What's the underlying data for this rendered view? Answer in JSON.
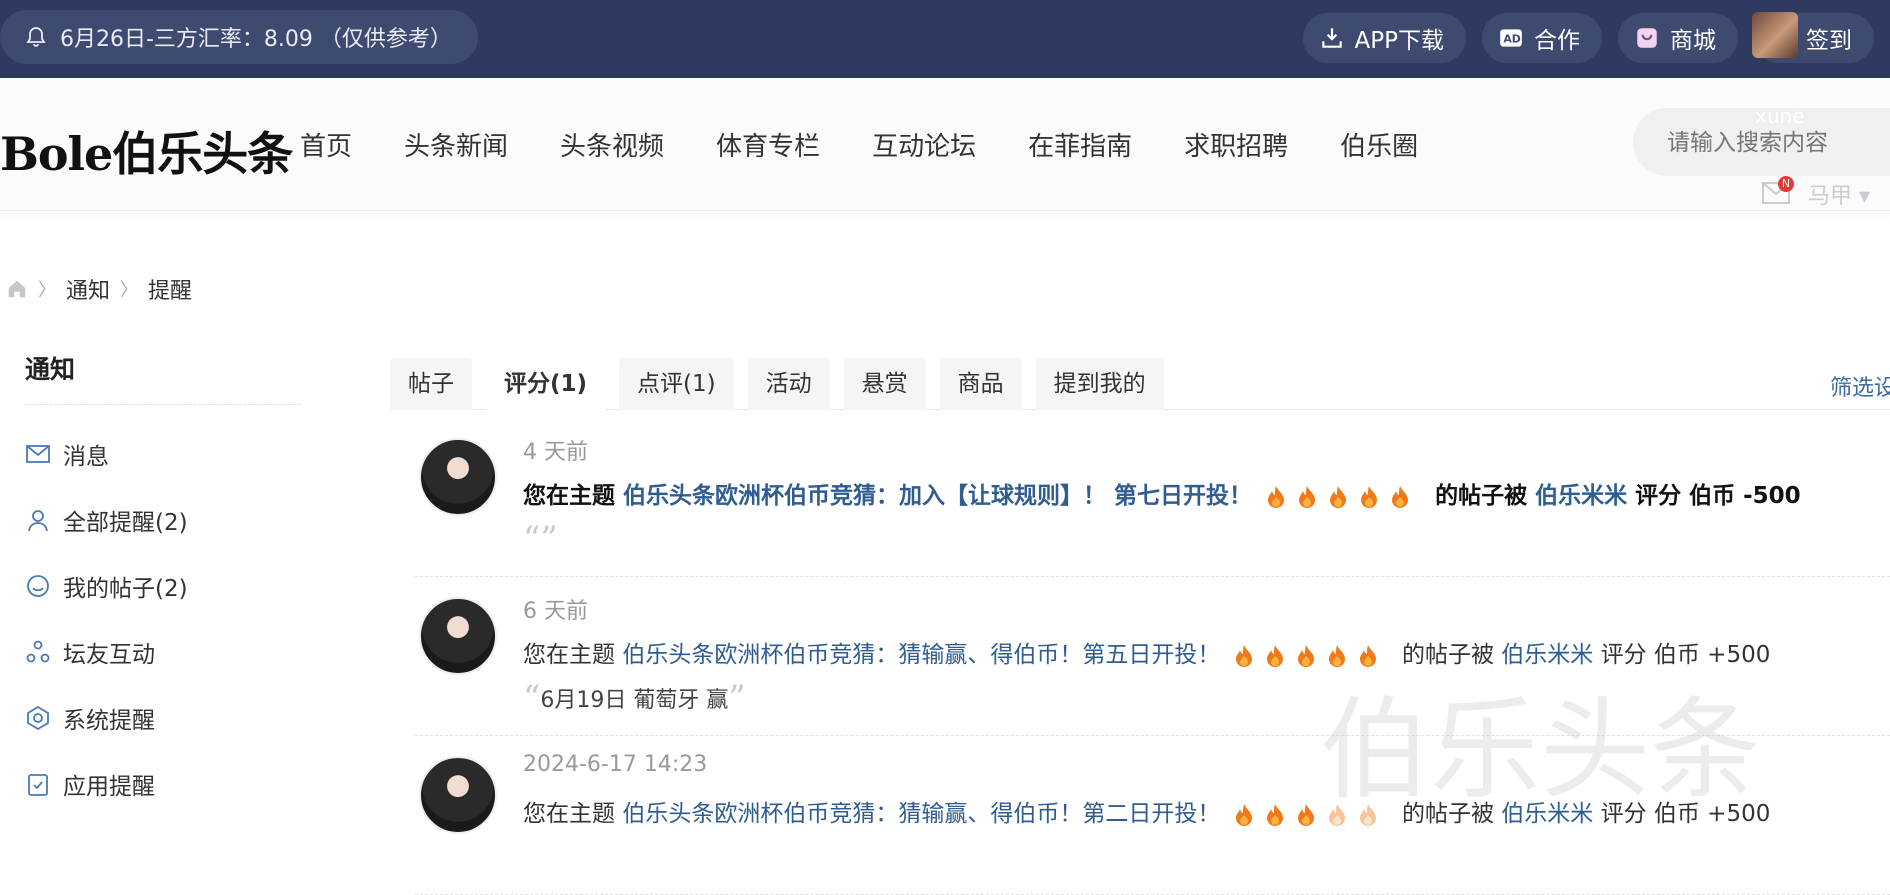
{
  "topbar": {
    "notice": "6月26日-三方汇率：8.09 （仅供参考）",
    "app_download": "APP下载",
    "cooperate": "合作",
    "mall": "商城",
    "signin": "签到"
  },
  "nav": {
    "logo": "Bole伯乐头条",
    "menu": [
      "首页",
      "头条新闻",
      "头条视频",
      "体育专栏",
      "互动论坛",
      "在菲指南",
      "求职招聘",
      "伯乐圈"
    ],
    "search_placeholder": "请输入搜索内容",
    "username": "xune",
    "mail_badge": "N",
    "user_menu": "马甲 ▾"
  },
  "breadcrumb": [
    "通知",
    "提醒"
  ],
  "sidebar": {
    "title": "通知",
    "items": [
      "消息",
      "全部提醒(2)",
      "我的帖子(2)",
      "坛友互动",
      "系统提醒",
      "应用提醒"
    ]
  },
  "tabs": [
    "帖子",
    "评分(1)",
    "点评(1)",
    "活动",
    "悬赏",
    "商品",
    "提到我的"
  ],
  "filter_label": "筛选设",
  "notifications": [
    {
      "time": "4 天前",
      "prefix": "您在主题",
      "topic": "伯乐头条欧洲杯伯币竞猜：加入【让球规则】！ 第七日开投！",
      "mid": "的帖子被",
      "user": "伯乐米米",
      "action": "评分 伯币 -500",
      "quote": ""
    },
    {
      "time": "6 天前",
      "prefix": "您在主题",
      "topic": "伯乐头条欧洲杯伯币竞猜：猜输赢、得伯币！第五日开投！",
      "mid": "的帖子被",
      "user": "伯乐米米",
      "action": "评分 伯币 +500",
      "quote": "6月19日 葡萄牙 赢"
    },
    {
      "time": "2024-6-17 14:23",
      "prefix": "您在主题",
      "topic": "伯乐头条欧洲杯伯币竞猜：猜输赢、得伯币！第二日开投！",
      "mid": "的帖子被",
      "user": "伯乐米米",
      "action": "评分 伯币 +500",
      "quote": ""
    }
  ],
  "colors": {
    "topbar": "#2f3a5e",
    "link": "#2f5d92",
    "flame": "#f07a1a"
  }
}
